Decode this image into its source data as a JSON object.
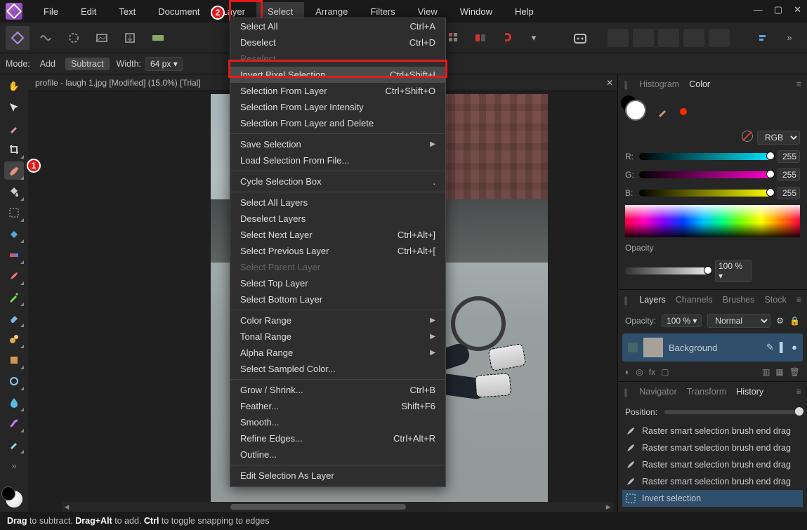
{
  "menubar": [
    "File",
    "Edit",
    "Text",
    "Document",
    "Layer",
    "Select",
    "Arrange",
    "Filters",
    "View",
    "Window",
    "Help"
  ],
  "active_menu_index": 5,
  "contextbar": {
    "mode_label": "Mode:",
    "mode_add": "Add",
    "mode_subtract": "Subtract",
    "width_label": "Width:",
    "width_value": "64 px"
  },
  "doc_tab": "profile - laugh 1.jpg [Modified] (15.0%) [Trial]",
  "dropdown": {
    "groups": [
      [
        {
          "label": "Select All",
          "shortcut": "Ctrl+A"
        },
        {
          "label": "Deselect",
          "shortcut": "Ctrl+D"
        },
        {
          "label": "Reselect",
          "shortcut": "",
          "disabled": true
        },
        {
          "label": "Invert Pixel Selection",
          "shortcut": "Ctrl+Shift+I",
          "hl": true
        },
        {
          "label": "Selection From Layer",
          "shortcut": "Ctrl+Shift+O"
        },
        {
          "label": "Selection From Layer Intensity",
          "shortcut": ""
        },
        {
          "label": "Selection From Layer and Delete",
          "shortcut": ""
        }
      ],
      [
        {
          "label": "Save Selection",
          "shortcut": "",
          "submenu": true
        },
        {
          "label": "Load Selection From File...",
          "shortcut": ""
        }
      ],
      [
        {
          "label": "Cycle Selection Box",
          "shortcut": "."
        }
      ],
      [
        {
          "label": "Select All Layers",
          "shortcut": ""
        },
        {
          "label": "Deselect Layers",
          "shortcut": ""
        },
        {
          "label": "Select Next Layer",
          "shortcut": "Ctrl+Alt+]"
        },
        {
          "label": "Select Previous Layer",
          "shortcut": "Ctrl+Alt+["
        },
        {
          "label": "Select Parent Layer",
          "shortcut": "",
          "disabled": true
        },
        {
          "label": "Select Top Layer",
          "shortcut": ""
        },
        {
          "label": "Select Bottom Layer",
          "shortcut": ""
        }
      ],
      [
        {
          "label": "Color Range",
          "shortcut": "",
          "submenu": true
        },
        {
          "label": "Tonal Range",
          "shortcut": "",
          "submenu": true
        },
        {
          "label": "Alpha Range",
          "shortcut": "",
          "submenu": true
        },
        {
          "label": "Select Sampled Color...",
          "shortcut": ""
        }
      ],
      [
        {
          "label": "Grow / Shrink...",
          "shortcut": "Ctrl+B"
        },
        {
          "label": "Feather...",
          "shortcut": "Shift+F6"
        },
        {
          "label": "Smooth...",
          "shortcut": ""
        },
        {
          "label": "Refine Edges...",
          "shortcut": "Ctrl+Alt+R"
        },
        {
          "label": "Outline...",
          "shortcut": ""
        }
      ],
      [
        {
          "label": "Edit Selection As Layer",
          "shortcut": ""
        }
      ]
    ]
  },
  "right": {
    "tabs_top": {
      "histogram": "Histogram",
      "color": "Color"
    },
    "color_mode": "RGB",
    "channels": [
      {
        "lab": "R:",
        "val": "255"
      },
      {
        "lab": "G:",
        "val": "255"
      },
      {
        "lab": "B:",
        "val": "255"
      }
    ],
    "opacity_label": "Opacity",
    "opacity_value": "100 %",
    "layers_tabs": [
      "Layers",
      "Channels",
      "Brushes",
      "Stock"
    ],
    "layers_opacity_label": "Opacity:",
    "layers_opacity_value": "100 %",
    "blend_mode": "Normal",
    "layer_name": "Background",
    "nav_tabs": [
      "Navigator",
      "Transform",
      "History"
    ],
    "position_label": "Position:",
    "history": [
      "Raster smart selection brush end drag",
      "Raster smart selection brush end drag",
      "Raster smart selection brush end drag",
      "Raster smart selection brush end drag",
      "Invert selection"
    ]
  },
  "status": {
    "drag": "Drag",
    "drag_txt": " to subtract. ",
    "dragalt": "Drag+Alt",
    "dragalt_txt": " to add. ",
    "ctrl": "Ctrl",
    "ctrl_txt": " to toggle snapping to edges"
  },
  "callouts": {
    "one": "1",
    "two": "2"
  }
}
